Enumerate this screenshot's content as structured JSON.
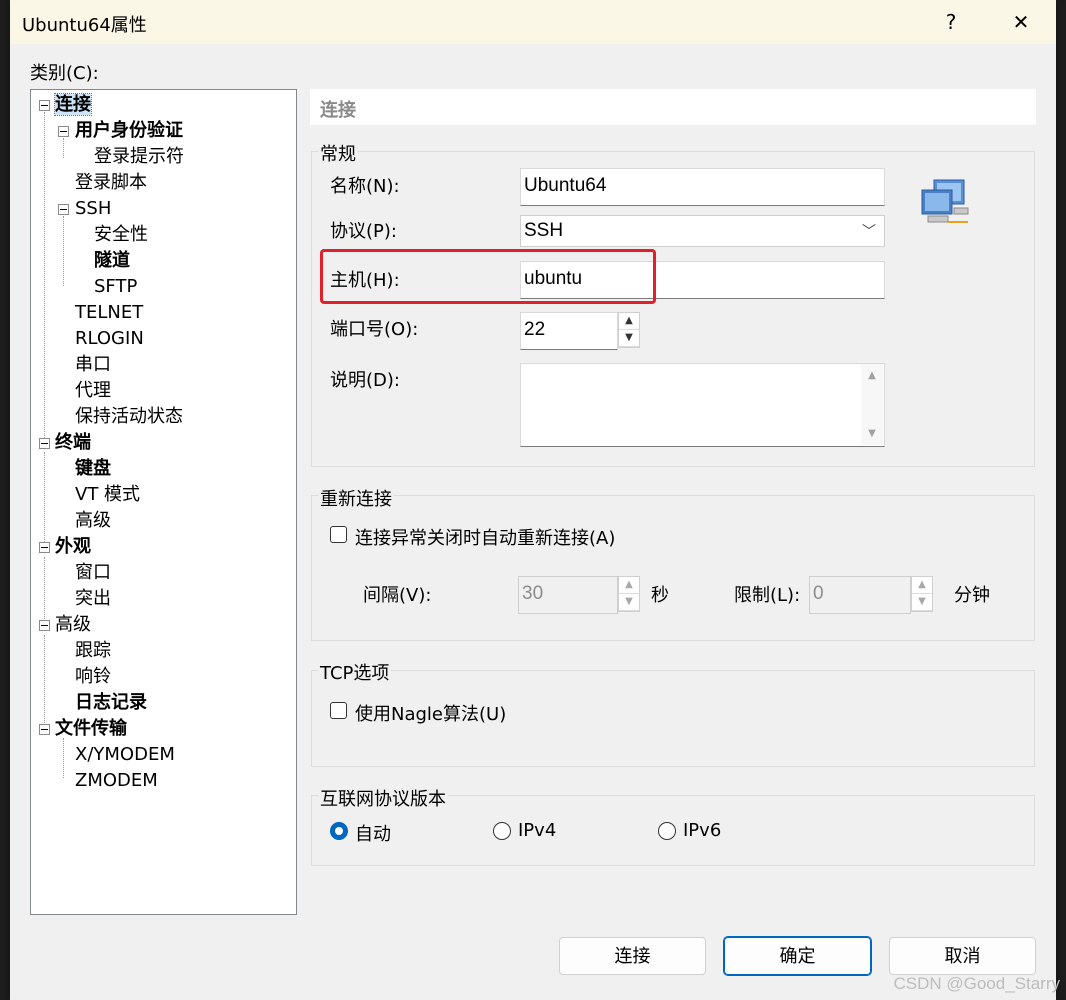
{
  "window": {
    "title": "Ubuntu64属性",
    "help_label": "?",
    "close_label": "✕"
  },
  "category_label": "类别(C):",
  "tree": [
    {
      "label": "连接",
      "bold": true,
      "selected": true
    },
    {
      "label": "用户身份验证",
      "bold": true
    },
    {
      "label": "登录提示符"
    },
    {
      "label": "登录脚本"
    },
    {
      "label": "SSH"
    },
    {
      "label": "安全性"
    },
    {
      "label": "隧道",
      "bold": true
    },
    {
      "label": "SFTP"
    },
    {
      "label": "TELNET"
    },
    {
      "label": "RLOGIN"
    },
    {
      "label": "串口"
    },
    {
      "label": "代理"
    },
    {
      "label": "保持活动状态"
    },
    {
      "label": "终端",
      "bold": true
    },
    {
      "label": "键盘",
      "bold": true
    },
    {
      "label": "VT 模式"
    },
    {
      "label": "高级"
    },
    {
      "label": "外观",
      "bold": true
    },
    {
      "label": "窗口"
    },
    {
      "label": "突出"
    },
    {
      "label": "高级"
    },
    {
      "label": "跟踪"
    },
    {
      "label": "响铃"
    },
    {
      "label": "日志记录",
      "bold": true
    },
    {
      "label": "文件传输",
      "bold": true
    },
    {
      "label": "X/YMODEM"
    },
    {
      "label": "ZMODEM"
    }
  ],
  "page_header": "连接",
  "general": {
    "title": "常规",
    "name_label": "名称(N):",
    "name_value": "Ubuntu64",
    "protocol_label": "协议(P):",
    "protocol_value": "SSH",
    "host_label": "主机(H):",
    "host_value": "ubuntu",
    "port_label": "端口号(O):",
    "port_value": "22",
    "desc_label": "说明(D):",
    "desc_value": ""
  },
  "reconnect": {
    "title": "重新连接",
    "auto_label": "连接异常关闭时自动重新连接(A)",
    "interval_label": "间隔(V):",
    "interval_value": "30",
    "interval_unit": "秒",
    "limit_label": "限制(L):",
    "limit_value": "0",
    "limit_unit": "分钟"
  },
  "tcp": {
    "title": "TCP选项",
    "nagle_label": "使用Nagle算法(U)"
  },
  "ip": {
    "title": "互联网协议版本",
    "options": [
      "自动",
      "IPv4",
      "IPv6"
    ],
    "selected": "自动"
  },
  "buttons": {
    "connect": "连接",
    "ok": "确定",
    "cancel": "取消"
  },
  "watermark": "CSDN @Good_Starry",
  "colors": {
    "highlight": "#e0202a",
    "accent": "#0067c0"
  }
}
